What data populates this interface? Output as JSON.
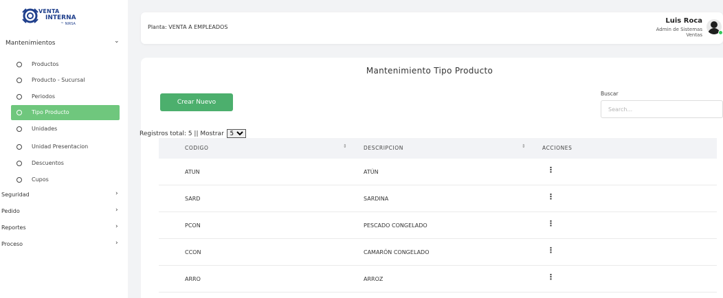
{
  "logo": {
    "line1": "VENTA",
    "line2": "INTERNA",
    "sub": "™ NIRSA"
  },
  "sidebar": {
    "section_label": "Mantenimientos",
    "sub_items": [
      {
        "label": "Productos",
        "active": false
      },
      {
        "label": "Producto - Sucursal",
        "active": false
      },
      {
        "label": "Periodos",
        "active": false
      },
      {
        "label": "Tipo Producto",
        "active": true
      },
      {
        "label": "Unidades",
        "active": false
      },
      {
        "label": "Unidad Presentacion",
        "active": false
      },
      {
        "label": "Descuentos",
        "active": false
      },
      {
        "label": "Cupos",
        "active": false
      }
    ],
    "top_items": [
      {
        "label": "Seguridad"
      },
      {
        "label": "Pedido"
      },
      {
        "label": "Reportes"
      },
      {
        "label": "Proceso"
      }
    ],
    "active_color": "#6fc77d"
  },
  "header": {
    "planta": "Planta: VENTA A EMPLEADOS",
    "user_name": "Luis Roca",
    "user_role": "Admin de Sistemas",
    "user_dept": "Ventas"
  },
  "main": {
    "title": "Mantenimiento Tipo Producto",
    "create_button": "Crear Nuevo",
    "search_label": "Buscar",
    "search_placeholder": "Search...",
    "registros_text": "Registros total: 5 || Mostrar",
    "page_size": "5",
    "columns": [
      "CODIGO",
      "DESCRIPCION",
      "ACCIONES"
    ],
    "rows": [
      {
        "codigo": "ATUN",
        "descripcion": "ATÚN"
      },
      {
        "codigo": "SARD",
        "descripcion": "SARDINA"
      },
      {
        "codigo": "PCON",
        "descripcion": "PESCADO CONGELADO"
      },
      {
        "codigo": "CCON",
        "descripcion": "CAMARÓN CONGELADO"
      },
      {
        "codigo": "ARRO",
        "descripcion": "ARROZ"
      }
    ],
    "accent_color": "#4caf6d"
  }
}
